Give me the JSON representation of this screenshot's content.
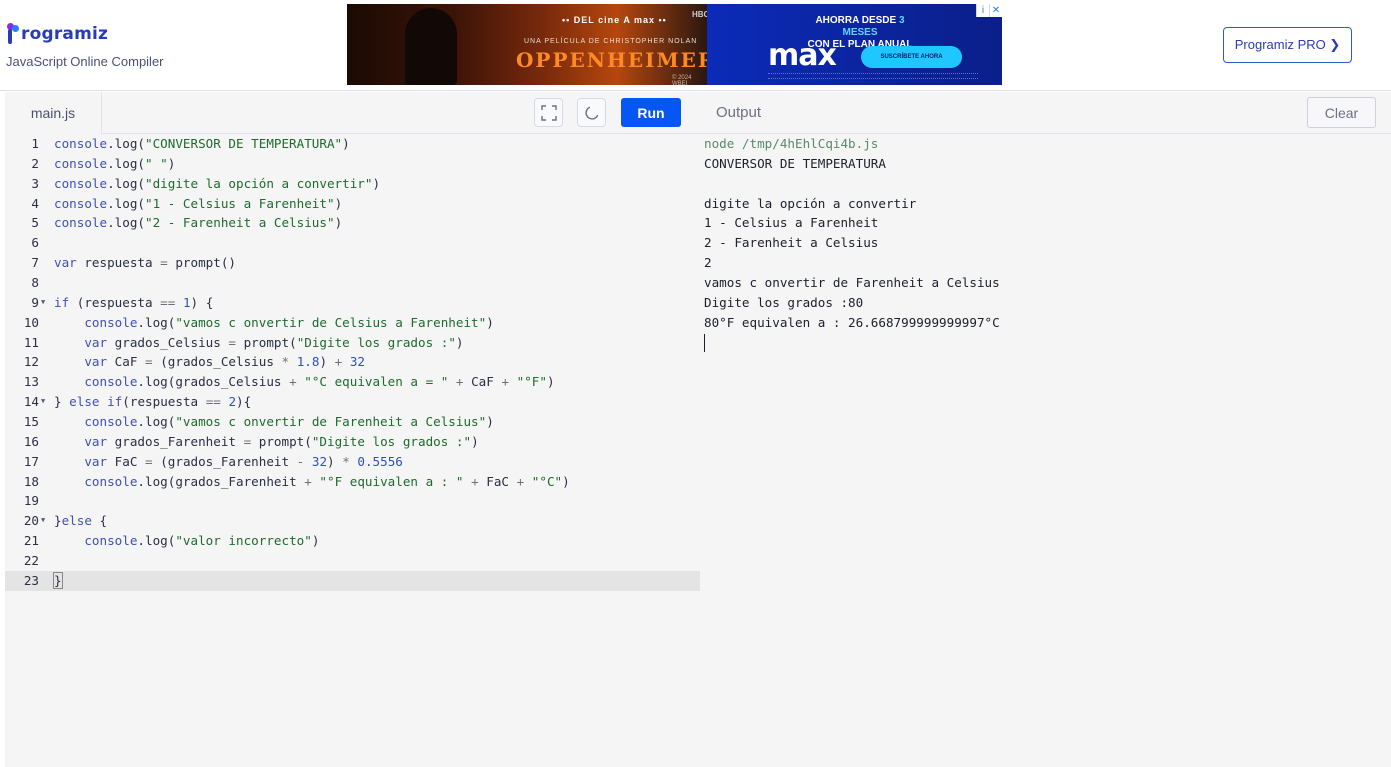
{
  "brand": {
    "name": "rogramiz",
    "subtitle": "JavaScript Online Compiler"
  },
  "ad": {
    "topline": "•• DEL cine A max ••",
    "director": "UNA PELÍCULA DE CHRISTOPHER NOLAN",
    "title": "OPPENHEIMER",
    "hbo": "HBO",
    "year": "© 2024 WBEI",
    "promo_line1": "AHORRA DESDE",
    "promo_highlight": "3 MESES",
    "promo_line2": "CON EL PLAN ANUAL",
    "logo": "max",
    "cta": "SUSCRÍBETE AHORA",
    "info_icon": "i",
    "close_icon": "✕"
  },
  "pro_button": "Programiz PRO ❯",
  "editor": {
    "file_tab": "main.js",
    "run_label": "Run",
    "icons": {
      "fullscreen": "fullscreen-icon",
      "dark_mode": "moon-icon"
    },
    "lines": [
      {
        "n": "1",
        "text": "console.log(\"CONVERSOR DE TEMPERATURA\")"
      },
      {
        "n": "2",
        "text": "console.log(\" \")"
      },
      {
        "n": "3",
        "text": "console.log(\"digite la opción a convertir\")"
      },
      {
        "n": "4",
        "text": "console.log(\"1 - Celsius a Farenheit\")"
      },
      {
        "n": "5",
        "text": "console.log(\"2 - Farenheit a Celsius\")"
      },
      {
        "n": "6",
        "text": ""
      },
      {
        "n": "7",
        "text": "var respuesta = prompt()"
      },
      {
        "n": "8",
        "text": ""
      },
      {
        "n": "9",
        "text": "if (respuesta == 1) {",
        "fold": true
      },
      {
        "n": "10",
        "text": "    console.log(\"vamos c onvertir de Celsius a Farenheit\")"
      },
      {
        "n": "11",
        "text": "    var grados_Celsius = prompt(\"Digite los grados :\")"
      },
      {
        "n": "12",
        "text": "    var CaF = (grados_Celsius * 1.8) + 32"
      },
      {
        "n": "13",
        "text": "    console.log(grados_Celsius + \"°C equivalen a = \" + CaF + \"°F\")"
      },
      {
        "n": "14",
        "text": "} else if(respuesta == 2){",
        "fold": true
      },
      {
        "n": "15",
        "text": "    console.log(\"vamos c onvertir de Farenheit a Celsius\")"
      },
      {
        "n": "16",
        "text": "    var grados_Farenheit = prompt(\"Digite los grados :\")"
      },
      {
        "n": "17",
        "text": "    var FaC = (grados_Farenheit - 32) * 0.5556"
      },
      {
        "n": "18",
        "text": "    console.log(grados_Farenheit + \"°F equivalen a : \" + FaC + \"°C\")"
      },
      {
        "n": "19",
        "text": ""
      },
      {
        "n": "20",
        "text": "}else {",
        "fold": true
      },
      {
        "n": "21",
        "text": "    console.log(\"valor incorrecto\")"
      },
      {
        "n": "22",
        "text": ""
      },
      {
        "n": "23",
        "text": "}",
        "active": true
      }
    ]
  },
  "output": {
    "title": "Output",
    "clear_label": "Clear",
    "lines": [
      {
        "text": "node /tmp/4hEhlCqi4b.js",
        "cmd": true
      },
      {
        "text": "CONVERSOR DE TEMPERATURA"
      },
      {
        "text": " "
      },
      {
        "text": "digite la opción a convertir"
      },
      {
        "text": "1 - Celsius a Farenheit"
      },
      {
        "text": "2 - Farenheit a Celsius"
      },
      {
        "text": "2"
      },
      {
        "text": "vamos c onvertir de Farenheit a Celsius"
      },
      {
        "text": "Digite los grados :80"
      },
      {
        "text": "80°F equivalen a : 26.668799999999997°C"
      }
    ]
  },
  "colors": {
    "brand": "#2a3bb7",
    "run_button": "#0556f3",
    "keyword": "#3f51b5",
    "string": "#1f6b2e",
    "number": "#2a52be"
  }
}
